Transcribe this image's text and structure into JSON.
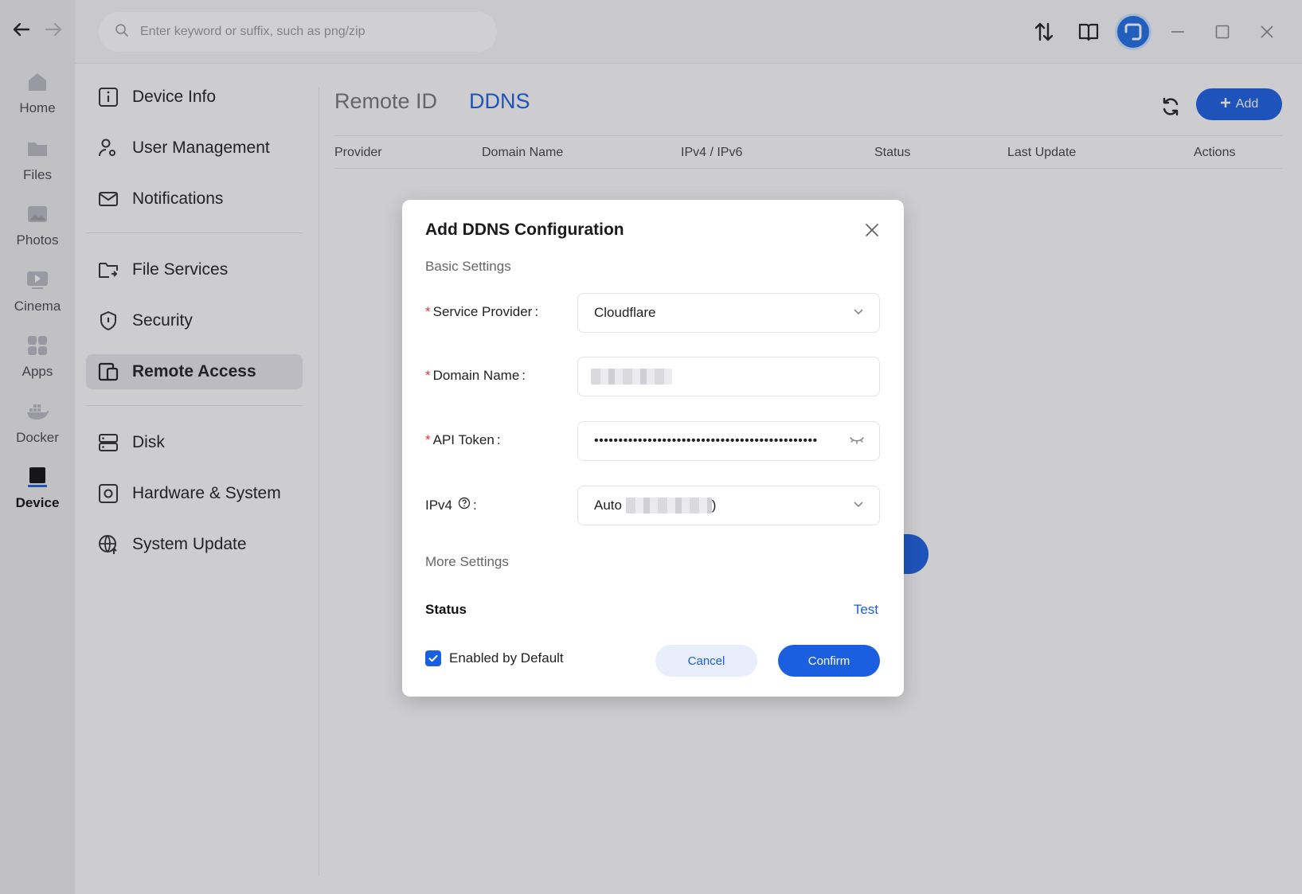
{
  "toolbar": {
    "search_placeholder": "Enter keyword or suffix, such as png/zip",
    "icons": [
      "back-arrow-icon",
      "forward-arrow-icon",
      "transfer-icon",
      "book-icon",
      "avatar",
      "minimize-icon",
      "maximize-icon",
      "close-icon"
    ]
  },
  "rail": {
    "items": [
      {
        "label": "Home",
        "icon": "home-icon"
      },
      {
        "label": "Files",
        "icon": "folder-icon"
      },
      {
        "label": "Photos",
        "icon": "photo-icon"
      },
      {
        "label": "Cinema",
        "icon": "play-icon"
      },
      {
        "label": "Apps",
        "icon": "apps-icon"
      },
      {
        "label": "Docker",
        "icon": "docker-icon"
      },
      {
        "label": "Device",
        "icon": "device-icon"
      }
    ],
    "active": "Device"
  },
  "sidebar": {
    "items": [
      {
        "label": "Device Info"
      },
      {
        "label": "User Management"
      },
      {
        "label": "Notifications"
      },
      {
        "label": "File Services"
      },
      {
        "label": "Security"
      },
      {
        "label": "Remote Access"
      },
      {
        "label": "Disk"
      },
      {
        "label": "Hardware & System"
      },
      {
        "label": "System Update"
      }
    ],
    "active": "Remote Access"
  },
  "main": {
    "tabs": [
      {
        "label": "Remote ID"
      },
      {
        "label": "DDNS"
      }
    ],
    "active_tab": "DDNS",
    "add_label": "Add",
    "columns": [
      "Provider",
      "Domain Name",
      "IPv4 / IPv6",
      "Status",
      "Last Update",
      "Actions"
    ]
  },
  "modal": {
    "title": "Add DDNS Configuration",
    "basic_settings": "Basic Settings",
    "service_provider_label": "Service Provider",
    "service_provider_value": "Cloudflare",
    "domain_name_label": "Domain Name",
    "api_token_label": "API Token",
    "api_token_value": "••••••••••••••••••••••••••••••••••••••••••••••",
    "ipv4_label": "IPv4",
    "ipv4_value_prefix": "Auto",
    "ipv4_value_suffix": ")",
    "colon": ":",
    "required_mark": "*",
    "more_settings": "More Settings",
    "status_label": "Status",
    "test_label": "Test",
    "enabled_label": "Enabled by Default",
    "enabled": true,
    "cancel_label": "Cancel",
    "confirm_label": "Confirm"
  },
  "colors": {
    "accent": "#1a5fe0",
    "required": "#e53535"
  }
}
